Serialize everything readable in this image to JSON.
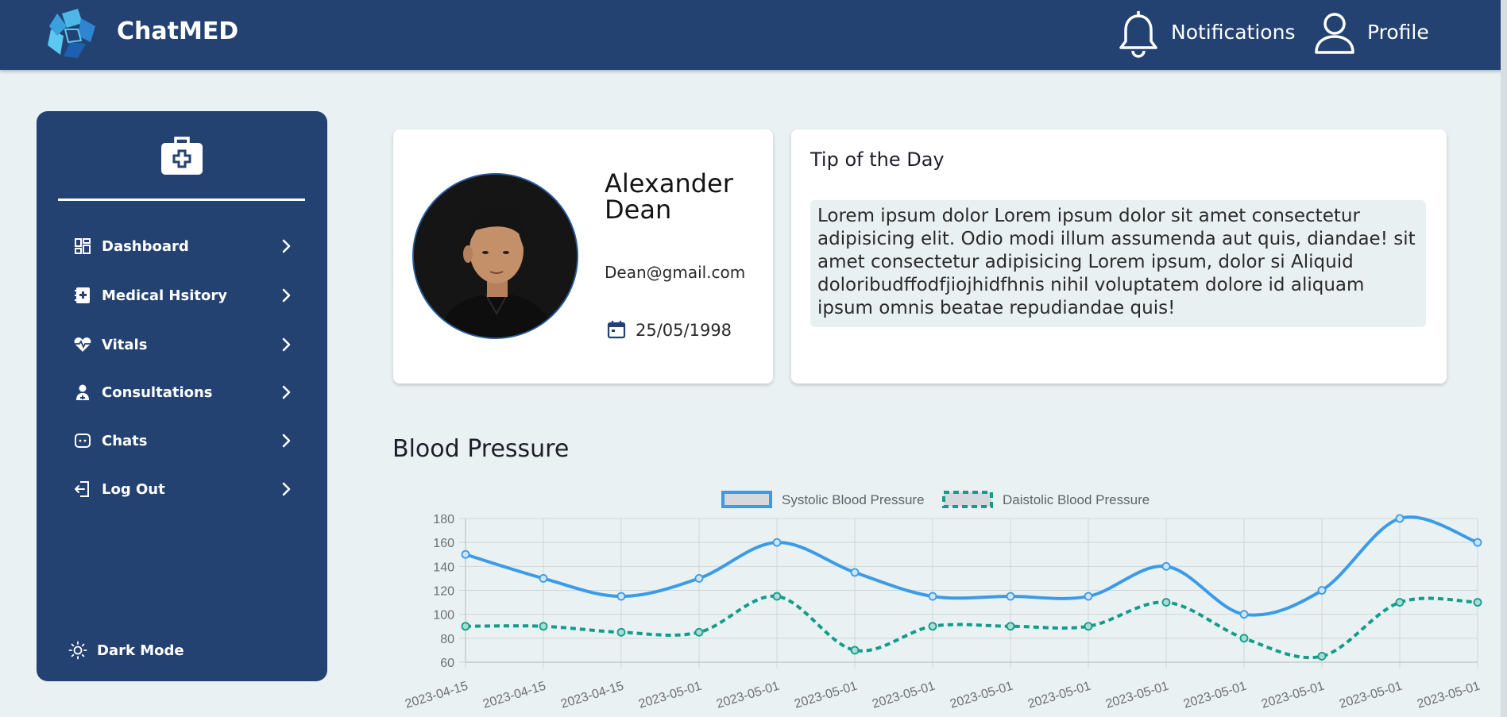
{
  "app": {
    "brand": "ChatMED"
  },
  "header": {
    "notifications_label": "Notifications",
    "profile_label": "Profile",
    "icons": [
      "logo-icon",
      "bell-icon",
      "user-icon"
    ]
  },
  "sidebar": {
    "items": [
      {
        "label": "Dashboard",
        "icon": "dashboard-icon"
      },
      {
        "label": "Medical Hsitory",
        "icon": "medical-book-icon"
      },
      {
        "label": "Vitals",
        "icon": "heartbeat-icon"
      },
      {
        "label": "Consultations",
        "icon": "doctor-icon"
      },
      {
        "label": "Chats",
        "icon": "chat-icon"
      },
      {
        "label": "Log Out",
        "icon": "logout-icon"
      }
    ],
    "dark_mode_label": "Dark Mode"
  },
  "profile": {
    "name": "Alexander Dean",
    "email": "Dean@gmail.com",
    "dob": "25/05/1998"
  },
  "tip": {
    "title": "Tip of the Day",
    "body": "Lorem ipsum dolor Lorem ipsum dolor sit amet consectetur adipisicing elit. Odio modi illum assumenda aut quis, diandae! sit amet consectetur adipisicing Lorem ipsum, dolor si Aliquid doloribudffodfjiojhidfhnis nihil voluptatem dolore id aliquam ipsum omnis beatae repudiandae quis!"
  },
  "blood_pressure": {
    "title": "Blood Pressure"
  },
  "colors": {
    "header_bg": "#234272",
    "page_bg": "#e9f1f3",
    "systolic": "#3b9be6",
    "diastolic": "#149c8a"
  },
  "chart_data": {
    "type": "line",
    "title": "",
    "xlabel": "",
    "ylabel": "",
    "x": [
      "2023-04-15",
      "2023-04-15",
      "2023-04-15",
      "2023-05-01",
      "2023-05-01",
      "2023-05-01",
      "2023-05-01",
      "2023-05-01",
      "2023-05-01",
      "2023-05-01",
      "2023-05-01",
      "2023-05-01",
      "2023-05-01",
      "2023-05-01"
    ],
    "series": [
      {
        "name": "Systolic Blood Pressure",
        "values": [
          150,
          130,
          115,
          130,
          160,
          135,
          115,
          115,
          115,
          140,
          100,
          120,
          180,
          160
        ],
        "style": "solid",
        "color": "#3b9be6"
      },
      {
        "name": "Daistolic Blood Pressure",
        "values": [
          90,
          90,
          85,
          85,
          115,
          70,
          90,
          90,
          90,
          110,
          80,
          65,
          110,
          110
        ],
        "style": "dashed",
        "color": "#149c8a"
      }
    ],
    "ylim": [
      60,
      180
    ],
    "yticks": [
      60,
      80,
      100,
      120,
      140,
      160,
      180
    ],
    "grid": true,
    "legend": "top-center"
  }
}
